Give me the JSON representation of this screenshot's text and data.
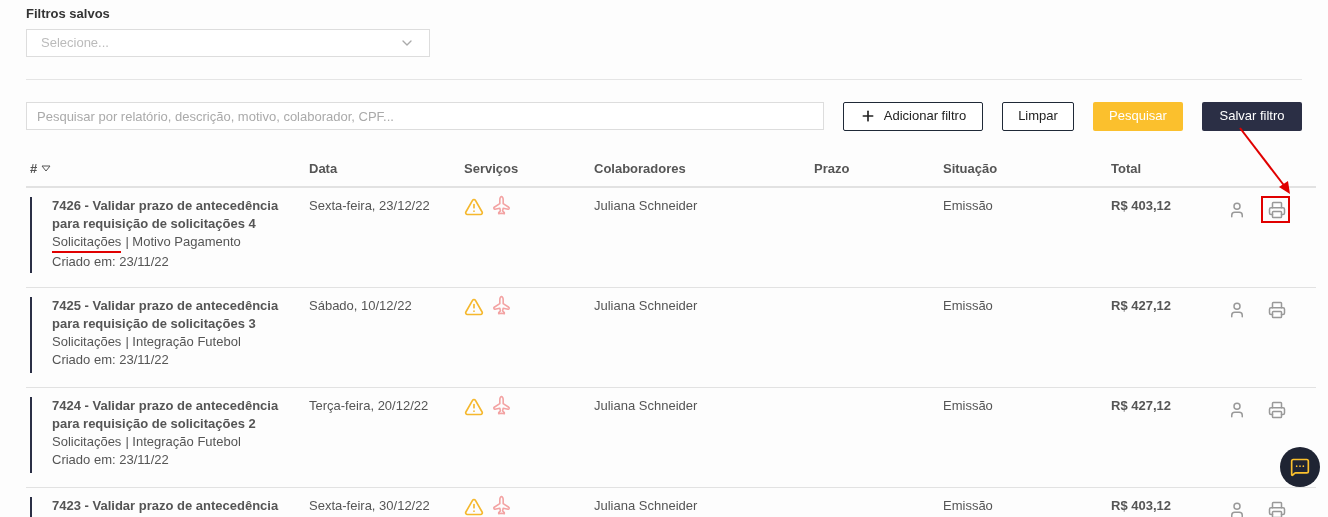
{
  "saved_filters": {
    "label": "Filtros salvos",
    "placeholder": "Selecione..."
  },
  "search": {
    "placeholder": "Pesquisar por relatório, descrição, motivo, colaborador, CPF..."
  },
  "actions": [
    {
      "label": "Adicionar filtro",
      "kind": "add"
    },
    {
      "label": "Limpar",
      "kind": "outline"
    },
    {
      "label": "Pesquisar",
      "kind": "primary"
    },
    {
      "label": "Salvar filtro",
      "kind": "dark"
    }
  ],
  "table": {
    "columns": [
      "#",
      "Data",
      "Serviços",
      "Colaboradores",
      "Prazo",
      "Situação",
      "Total"
    ],
    "rows": [
      {
        "title": "7426 - Validar prazo de antecedência para requisição de solicitações 4",
        "category": "Solicitações",
        "reason": "| Motivo Pagamento",
        "created": "Criado em: 23/11/22",
        "date": "Sexta-feira, 23/12/22",
        "employee": "Juliana Schneider",
        "status": "Emissão",
        "total": "R$ 403,12",
        "highlighted": true
      },
      {
        "title": "7425 - Validar prazo de antecedência para requisição de solicitações 3",
        "category": "Solicitações",
        "reason": "| Integração Futebol",
        "created": "Criado em: 23/11/22",
        "date": "Sábado, 10/12/22",
        "employee": "Juliana Schneider",
        "status": "Emissão",
        "total": "R$ 427,12",
        "highlighted": false
      },
      {
        "title": "7424 - Validar prazo de antecedência para requisição de solicitações 2",
        "category": "Solicitações",
        "reason": "| Integração Futebol",
        "created": "Criado em: 23/11/22",
        "date": "Terça-feira, 20/12/22",
        "employee": "Juliana Schneider",
        "status": "Emissão",
        "total": "R$ 427,12",
        "highlighted": false
      },
      {
        "title": "7423 - Validar prazo de antecedência",
        "date": "Sexta-feira, 30/12/22",
        "employee": "Juliana Schneider",
        "status": "Emissão",
        "total": "R$ 403,12",
        "highlighted": false
      }
    ]
  }
}
